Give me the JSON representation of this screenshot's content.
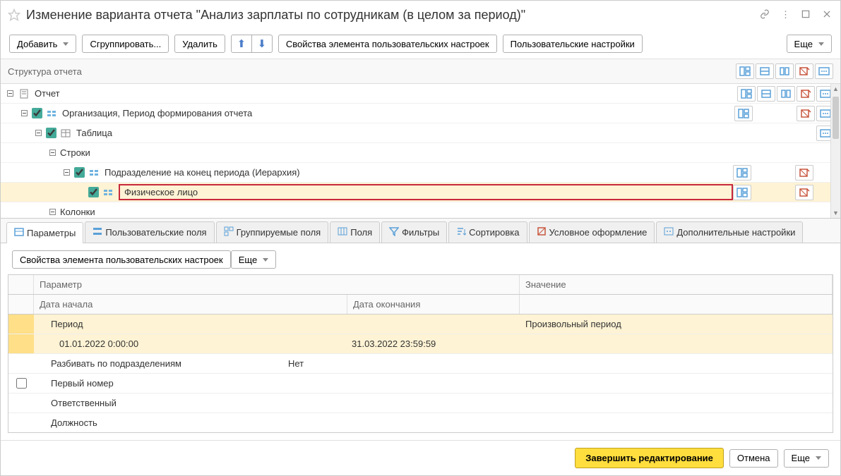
{
  "title": "Изменение варианта отчета \"Анализ зарплаты по сотрудникам (в целом за период)\"",
  "toolbar": {
    "add": "Добавить",
    "group": "Сгруппировать...",
    "delete": "Удалить",
    "props": "Свойства элемента пользовательских настроек",
    "user_settings": "Пользовательские настройки",
    "more": "Еще"
  },
  "structure": {
    "header": "Структура отчета",
    "rows": [
      {
        "indent": 0,
        "expander": "minus",
        "icon": "report",
        "label": "Отчет",
        "btns": [
          "f",
          "u",
          "s",
          "c",
          "e"
        ]
      },
      {
        "indent": 1,
        "expander": "minus",
        "cb": true,
        "icon": "grouping",
        "label": "Организация, Период формирования отчета",
        "btns": [
          "f",
          "",
          "",
          "c",
          "e"
        ]
      },
      {
        "indent": 2,
        "expander": "minus",
        "cb": true,
        "icon": "table",
        "label": "Таблица",
        "btns": [
          "",
          "",
          "",
          "",
          "e"
        ]
      },
      {
        "indent": 3,
        "expander": "minus",
        "label": "Строки"
      },
      {
        "indent": 4,
        "expander": "minus",
        "cb": true,
        "icon": "grouping",
        "label": "Подразделение на конец периода (Иерархия)",
        "btns": [
          "f",
          "",
          "",
          "c",
          ""
        ]
      },
      {
        "indent": 5,
        "hl": true,
        "cb": true,
        "icon": "grouping",
        "label": "Физическое лицо",
        "framed": true,
        "btns": [
          "f",
          "",
          "",
          "c",
          ""
        ]
      },
      {
        "indent": 3,
        "expander": "minus",
        "label": "Колонки"
      }
    ]
  },
  "tabs": [
    {
      "id": "params",
      "label": "Параметры",
      "active": true
    },
    {
      "id": "userfields",
      "label": "Пользовательские поля"
    },
    {
      "id": "groupfields",
      "label": "Группируемые поля"
    },
    {
      "id": "fields",
      "label": "Поля"
    },
    {
      "id": "filters",
      "label": "Фильтры"
    },
    {
      "id": "sort",
      "label": "Сортировка"
    },
    {
      "id": "cond",
      "label": "Условное оформление"
    },
    {
      "id": "extra",
      "label": "Дополнительные настройки"
    }
  ],
  "tab_toolbar": {
    "props": "Свойства элемента пользовательских настроек",
    "more": "Еще"
  },
  "grid": {
    "head_param": "Параметр",
    "head_value": "Значение",
    "head_start": "Дата начала",
    "head_end": "Дата окончания",
    "rows": [
      {
        "hl": true,
        "param": "Период",
        "value": "Произвольный период"
      },
      {
        "hl": true,
        "sub": true,
        "param": "01.01.2022 0:00:00",
        "end": "31.03.2022 23:59:59"
      },
      {
        "param": "Разбивать по подразделениям",
        "mid": "Нет"
      },
      {
        "param": "Первый номер",
        "cb": true
      },
      {
        "param": "Ответственный"
      },
      {
        "param": "Должность"
      }
    ]
  },
  "footer": {
    "finish": "Завершить редактирование",
    "cancel": "Отмена",
    "more": "Еще"
  }
}
